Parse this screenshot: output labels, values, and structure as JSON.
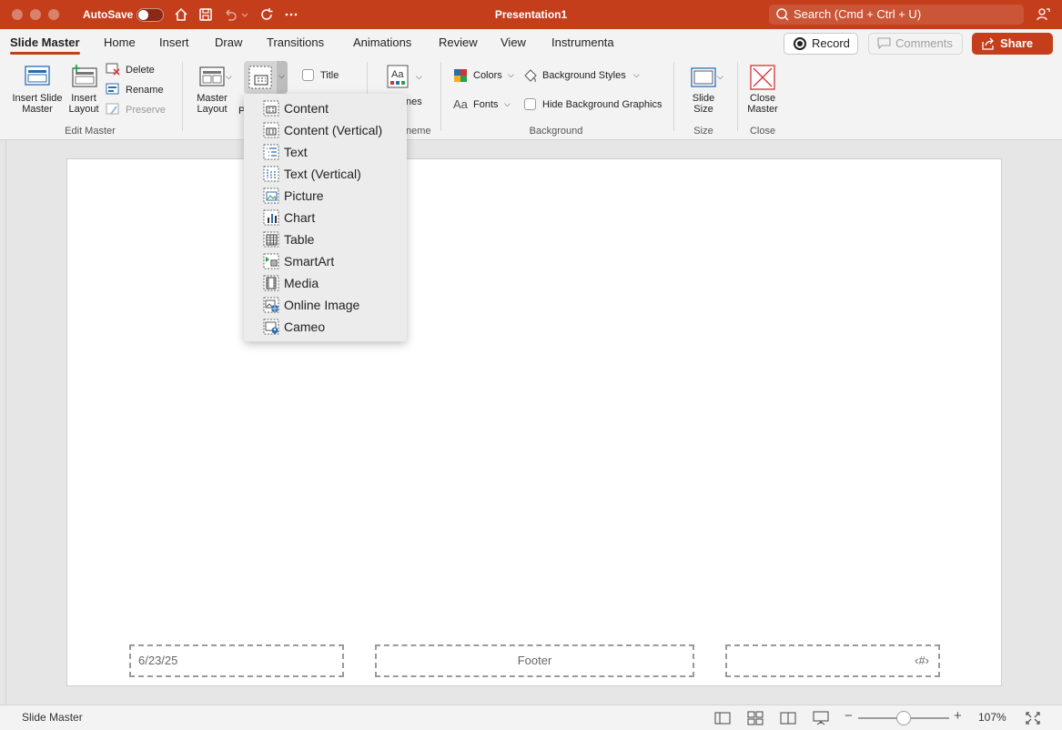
{
  "titlebar": {
    "autosave_label": "AutoSave",
    "document_title": "Presentation1",
    "search_placeholder": "Search (Cmd + Ctrl + U)",
    "brand_color": "#c43e1c"
  },
  "tabs": [
    {
      "label": "Slide Master",
      "active": true
    },
    {
      "label": "Home"
    },
    {
      "label": "Insert"
    },
    {
      "label": "Draw"
    },
    {
      "label": "Transitions"
    },
    {
      "label": "Animations"
    },
    {
      "label": "Review"
    },
    {
      "label": "View"
    },
    {
      "label": "Instrumenta"
    }
  ],
  "actions": {
    "record": "Record",
    "comments": "Comments",
    "share": "Share"
  },
  "ribbon": {
    "edit_master": {
      "insert_slide_master_line1": "Insert Slide",
      "insert_slide_master_line2": "Master",
      "insert_layout_line1": "Insert",
      "insert_layout_line2": "Layout",
      "delete": "Delete",
      "rename": "Rename",
      "preserve": "Preserve",
      "group_label": "Edit Master"
    },
    "master_layout": {
      "master_layout_line1": "Master",
      "master_layout_line2": "Layout",
      "insert_placeholder_partial": "P",
      "title_checkbox": "Title"
    },
    "theme": {
      "themes_partial": "nes",
      "group_label_partial": "neme"
    },
    "background": {
      "colors": "Colors",
      "fonts": "Fonts",
      "background_styles": "Background Styles",
      "hide_background_graphics": "Hide Background Graphics",
      "group_label": "Background"
    },
    "size": {
      "slide_size_line1": "Slide",
      "slide_size_line2": "Size",
      "group_label": "Size"
    },
    "close": {
      "close_master_line1": "Close",
      "close_master_line2": "Master",
      "group_label": "Close"
    }
  },
  "placeholder_menu": [
    {
      "label": "Content",
      "icon": "content-placeholder-icon"
    },
    {
      "label": "Content (Vertical)",
      "icon": "content-vertical-placeholder-icon"
    },
    {
      "label": "Text",
      "icon": "text-placeholder-icon"
    },
    {
      "label": "Text (Vertical)",
      "icon": "text-vertical-placeholder-icon"
    },
    {
      "label": "Picture",
      "icon": "picture-placeholder-icon"
    },
    {
      "label": "Chart",
      "icon": "chart-placeholder-icon"
    },
    {
      "label": "Table",
      "icon": "table-placeholder-icon"
    },
    {
      "label": "SmartArt",
      "icon": "smartart-placeholder-icon"
    },
    {
      "label": "Media",
      "icon": "media-placeholder-icon"
    },
    {
      "label": "Online Image",
      "icon": "online-image-placeholder-icon"
    },
    {
      "label": "Cameo",
      "icon": "cameo-placeholder-icon"
    }
  ],
  "slide": {
    "date": "6/23/25",
    "footer": "Footer",
    "slide_number": "‹#›"
  },
  "statusbar": {
    "view_name": "Slide Master",
    "zoom": "107%"
  }
}
